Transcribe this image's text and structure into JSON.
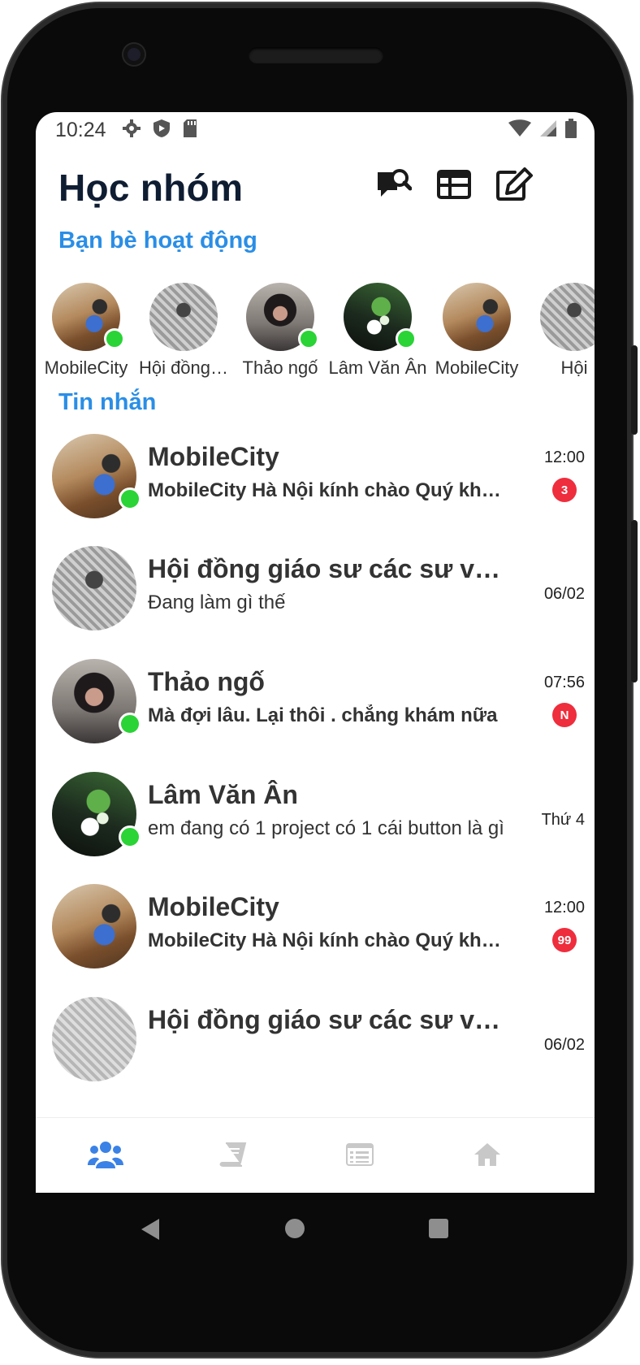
{
  "status_bar": {
    "time": "10:24",
    "left_icons": [
      "gear-icon",
      "shield-icon",
      "sd-card-icon"
    ],
    "right_icons": [
      "wifi-icon",
      "signal-icon",
      "battery-icon"
    ]
  },
  "header": {
    "title": "Học nhóm",
    "actions": [
      "search-chat-icon",
      "table-icon",
      "compose-icon"
    ]
  },
  "active_friends": {
    "title": "Bạn bè hoạt động",
    "items": [
      {
        "name": "MobileCity",
        "online": true
      },
      {
        "name": "Hội đồng…",
        "online": false
      },
      {
        "name": "Thảo ngố",
        "online": true
      },
      {
        "name": "Lâm Văn Ân",
        "online": true
      },
      {
        "name": "MobileCity",
        "online": false
      },
      {
        "name": "Hội",
        "online": false
      }
    ]
  },
  "messages": {
    "title": "Tin nhắn",
    "items": [
      {
        "name": "MobileCity",
        "preview": "MobileCity Hà Nội kính chào Quý khách hàng",
        "time": "12:00",
        "badge": "3",
        "unread": true,
        "online": true
      },
      {
        "name": "Hội đồng giáo sư các sư vãi thái",
        "preview": "Đang làm gì thế",
        "time": "06/02",
        "badge": "",
        "unread": false,
        "online": false
      },
      {
        "name": "Thảo ngố",
        "preview": "Mà đợi lâu.  Lại thôi . chẳng khám nữa",
        "time": "07:56",
        "badge": "N",
        "unread": true,
        "online": true
      },
      {
        "name": "Lâm Văn Ân",
        "preview": "em đang có 1 project có 1 cái button là gì",
        "time": "Thứ 4",
        "badge": "",
        "unread": false,
        "online": true
      },
      {
        "name": "MobileCity",
        "preview": "MobileCity Hà Nội kính chào Quý khách hàng",
        "time": "12:00",
        "badge": "99",
        "unread": true,
        "online": false
      },
      {
        "name": "Hội đồng giáo sư các sư vãi thái",
        "preview": "",
        "time": "06/02",
        "badge": "",
        "unread": false,
        "online": false
      }
    ]
  },
  "bottom_nav": {
    "items": [
      "groups-icon",
      "book-icon",
      "list-icon",
      "home-icon"
    ],
    "active_color": "#3b82e6",
    "inactive_color": "#c2c2c2"
  },
  "colors": {
    "accent": "#2a8ee6",
    "title": "#0f1d33",
    "online": "#2ad336",
    "badge": "#ee2d3d"
  }
}
